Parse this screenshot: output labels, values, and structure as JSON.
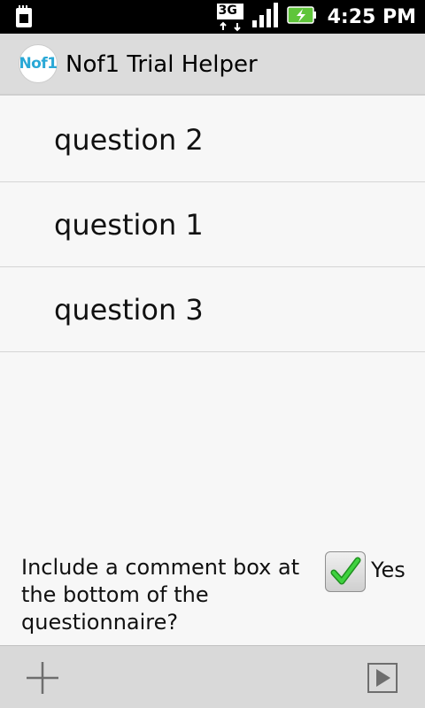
{
  "status_bar": {
    "time": "4:25 PM",
    "network_label": "3G",
    "icons": [
      "sd-card-icon",
      "3g-data-icon",
      "signal-icon",
      "battery-charging-icon"
    ]
  },
  "header": {
    "logo_text": "Nof1",
    "title": "Nof1 Trial Helper"
  },
  "questions": [
    {
      "label": "question 2"
    },
    {
      "label": "question 1"
    },
    {
      "label": "question 3"
    }
  ],
  "comment_option": {
    "label": "Include a comment box at the bottom of the questionnaire?",
    "checkbox_label": "Yes",
    "checked": true
  },
  "bottom_bar": {
    "icons": [
      "add-icon",
      "play-icon"
    ]
  },
  "colors": {
    "status_bar_bg": "#000000",
    "action_bar_bg": "#dcdcdc",
    "logo_accent": "#29a8d6",
    "check_green": "#2eb82e",
    "battery_green": "#5fc53a"
  }
}
